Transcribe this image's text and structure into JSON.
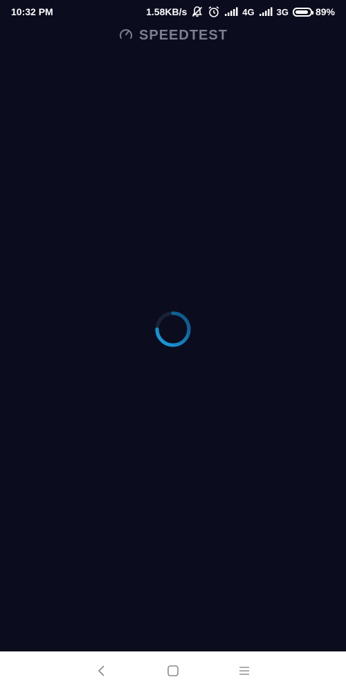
{
  "status_bar": {
    "time": "10:32 PM",
    "net_speed": "1.58KB/s",
    "network_1": "4G",
    "network_2": "3G",
    "battery_percent": "89%",
    "battery_level": 0.89
  },
  "header": {
    "title": "SPEEDTEST"
  },
  "loading": {
    "spinner_color": "#1a8fd1"
  },
  "nav": {
    "back_icon": "back-chevron-icon",
    "home_icon": "home-square-icon",
    "menu_icon": "menu-lines-icon"
  }
}
